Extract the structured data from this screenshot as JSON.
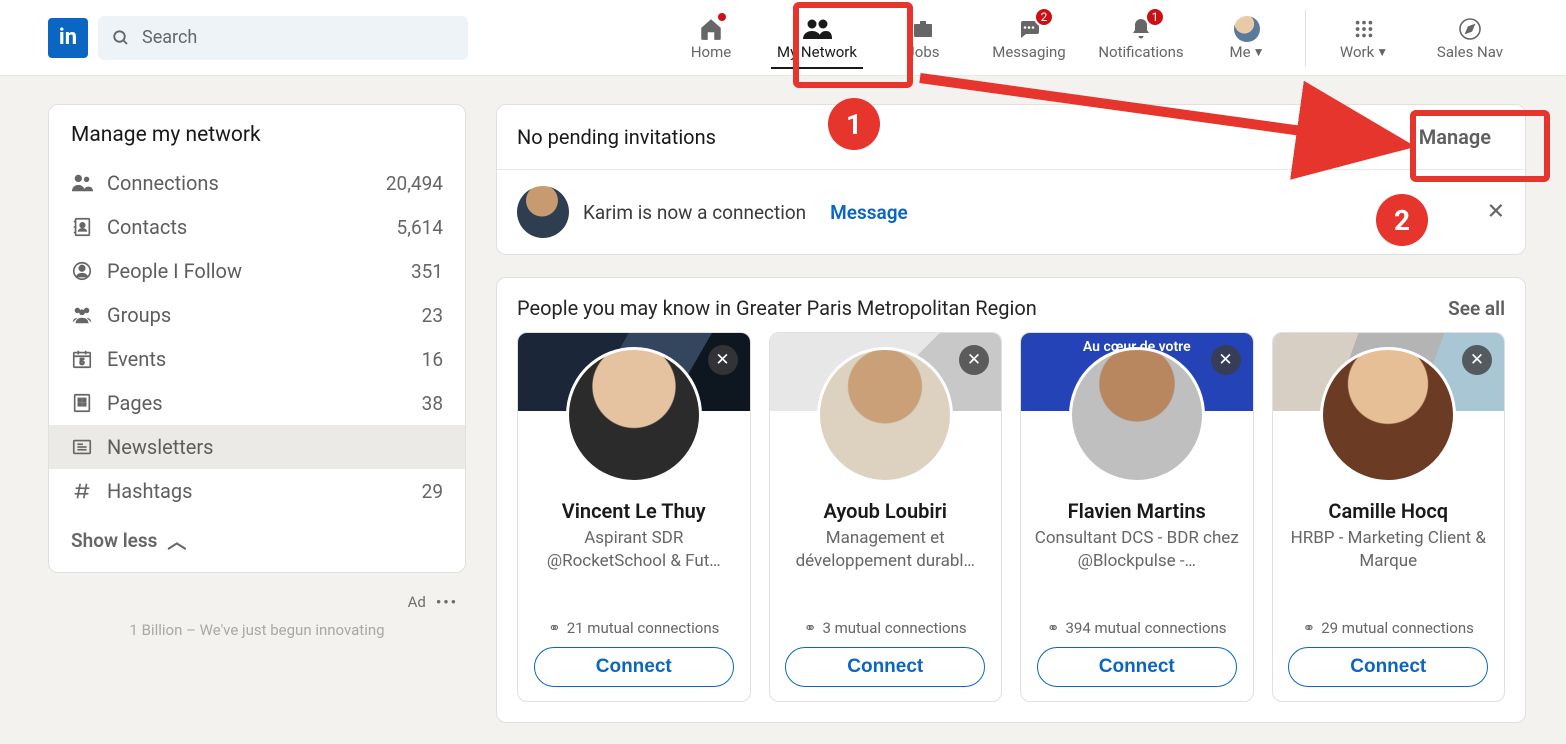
{
  "search": {
    "placeholder": "Search"
  },
  "nav": {
    "home": "Home",
    "mynetwork": "My Network",
    "jobs": "Jobs",
    "messaging": "Messaging",
    "notifications": "Notifications",
    "me": "Me",
    "work": "Work",
    "salesnav": "Sales Nav",
    "badges": {
      "home": "",
      "messaging": "2",
      "notifications": "1"
    }
  },
  "left": {
    "title": "Manage my network",
    "items": [
      {
        "label": "Connections",
        "count": "20,494"
      },
      {
        "label": "Contacts",
        "count": "5,614"
      },
      {
        "label": "People I Follow",
        "count": "351"
      },
      {
        "label": "Groups",
        "count": "23"
      },
      {
        "label": "Events",
        "count": "16"
      },
      {
        "label": "Pages",
        "count": "38"
      },
      {
        "label": "Newsletters",
        "count": ""
      },
      {
        "label": "Hashtags",
        "count": "29"
      }
    ],
    "show_less": "Show less",
    "ad_label": "Ad",
    "ad_tagline": "1 Billion – We've just begun innovating"
  },
  "invitations": {
    "title": "No pending invitations",
    "manage": "Manage",
    "line": "Karim is now a connection",
    "message": "Message"
  },
  "pymk": {
    "title": "People you may know in Greater Paris Metropolitan Region",
    "see_all": "See all",
    "connect": "Connect",
    "cover3_text": "Au cœur de votre",
    "people": [
      {
        "name": "Vincent Le Thuy",
        "title": "Aspirant SDR @RocketSchool & Fut…",
        "mutual": "21 mutual connections"
      },
      {
        "name": "Ayoub Loubiri",
        "title": "Management et développement durabl…",
        "mutual": "3 mutual connections"
      },
      {
        "name": "Flavien Martins",
        "title": "Consultant DCS - BDR chez @Blockpulse -…",
        "mutual": "394 mutual connections"
      },
      {
        "name": "Camille Hocq",
        "title": "HRBP - Marketing Client & Marque",
        "mutual": "29 mutual connections"
      }
    ]
  },
  "annotations": {
    "step1": "1",
    "step2": "2"
  }
}
